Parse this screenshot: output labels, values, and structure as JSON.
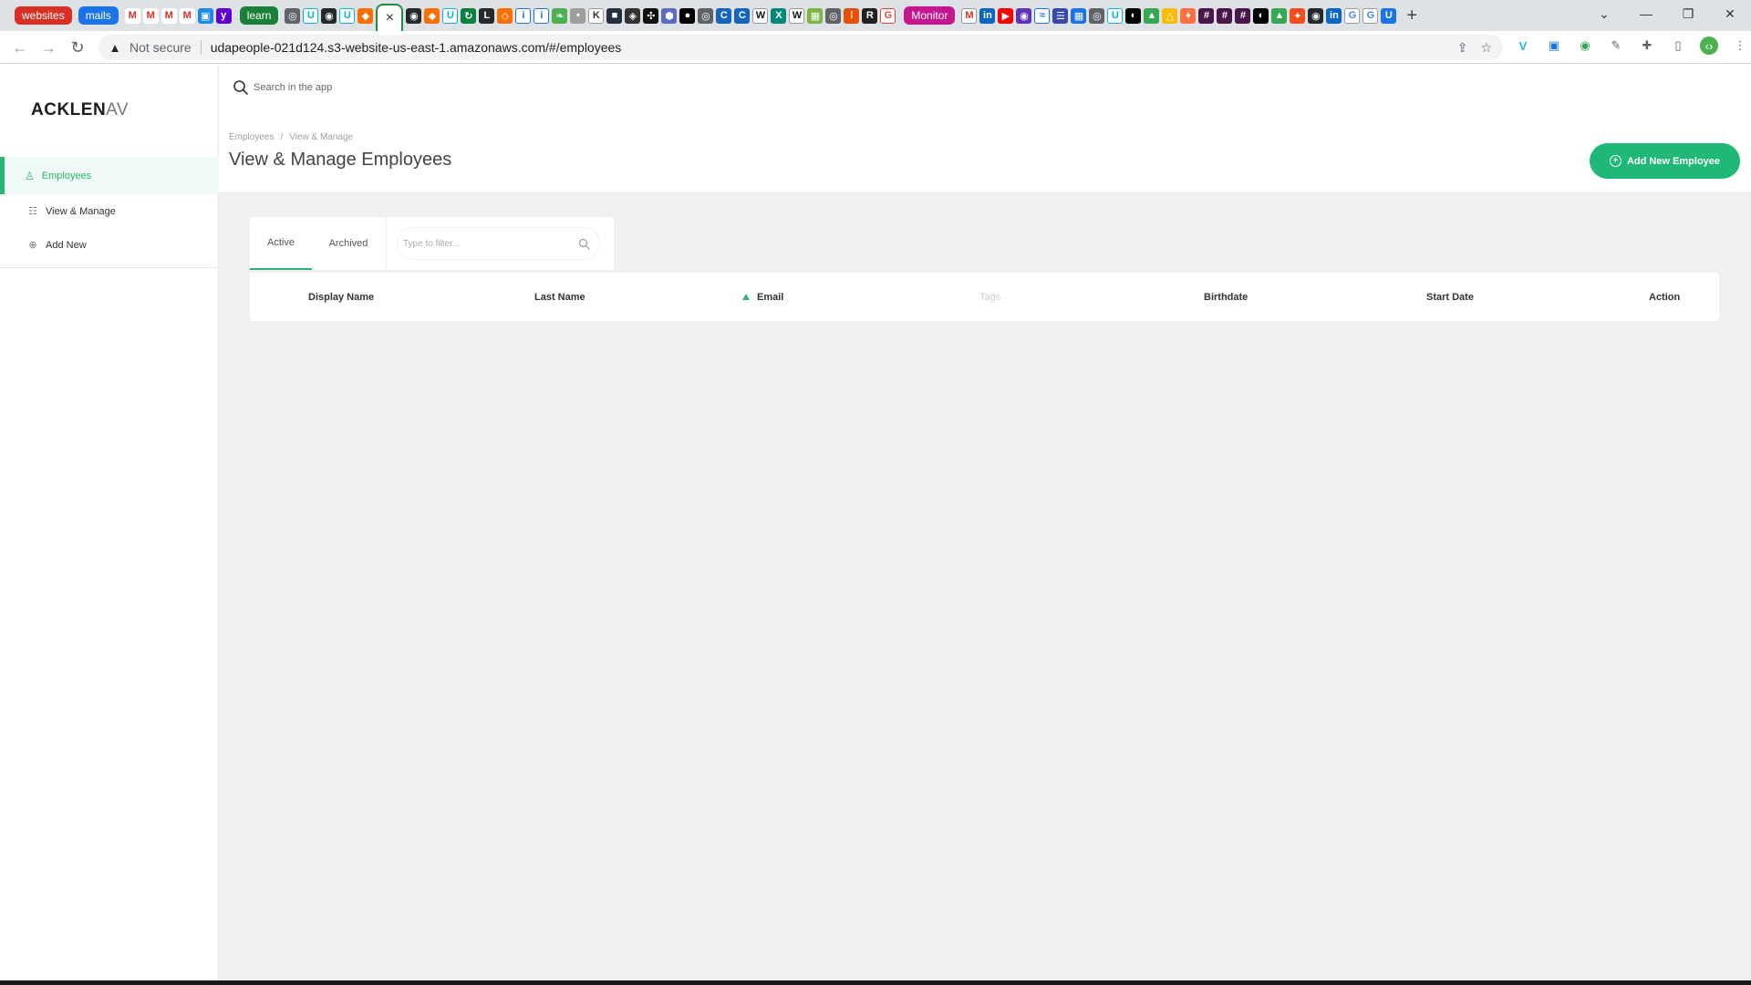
{
  "browser": {
    "tab_groups": [
      {
        "label": "websites",
        "color": "#d93025"
      },
      {
        "label": "mails",
        "color": "#1a73e8"
      },
      {
        "label": "learn",
        "color": "#188038"
      },
      {
        "label": "Monitor",
        "color": "#c5158f"
      }
    ],
    "active_tab_close": "×",
    "new_tab": "+",
    "window_controls": {
      "minimize": "—",
      "restore": "❐",
      "close": "✕"
    },
    "security_label": "Not secure",
    "url": "udapeople-021d124.s3-website-us-east-1.amazonaws.com/#/employees"
  },
  "app": {
    "logo_main": "ACKLEN",
    "logo_tail": "AV",
    "search": {
      "placeholder": "Search in the app"
    },
    "sidebar": {
      "parent": "Employees",
      "items": [
        {
          "label": "View & Manage",
          "icon": "list-icon"
        },
        {
          "label": "Add New",
          "icon": "plus-circle-icon"
        }
      ]
    },
    "breadcrumb": [
      "Employees",
      "View & Manage"
    ],
    "breadcrumb_sep": "/",
    "page_title": "View & Manage Employees",
    "add_button": "Add New Employee",
    "tabs": {
      "active": "Active",
      "archived": "Archived"
    },
    "filter": {
      "placeholder": "Type to filter..."
    },
    "table": {
      "columns": [
        "Display Name",
        "Last Name",
        "Email",
        "Tags",
        "Birthdate",
        "Start Date",
        "Action"
      ],
      "sorted_column": "Email",
      "muted_column": "Tags",
      "rows": []
    }
  },
  "colors": {
    "accent": "#2bb673",
    "button": "#1fb877",
    "background": "#eef0f1"
  }
}
